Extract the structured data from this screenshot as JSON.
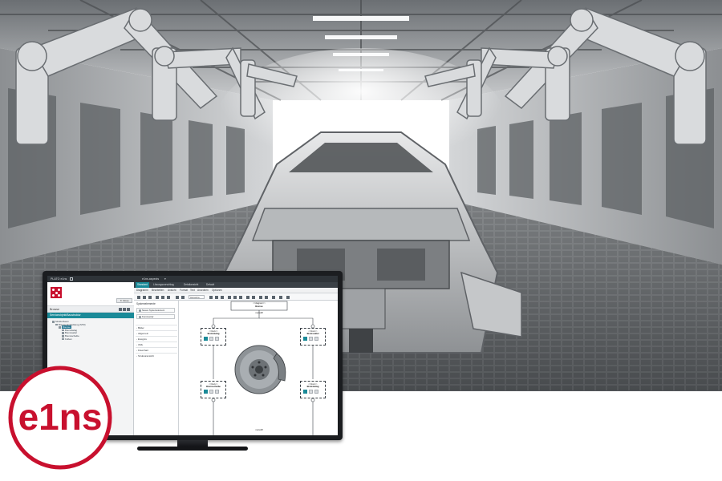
{
  "app": {
    "title": "PLATO e1ns",
    "document_title": "e1ns.aspects",
    "document_caret": "▾"
  },
  "left_panel": {
    "close_label": "✕ Close",
    "panel_title": "Browse",
    "section_label": "Serviceobjekt/Baustruktur",
    "tree": [
      {
        "label": "Strukturbaum",
        "indent": 1,
        "selected": false
      },
      {
        "label": "Bremse Entwicklung (STR)",
        "indent": 2,
        "selected": false
      },
      {
        "label": "Bremse",
        "indent": 3,
        "selected": true
      },
      {
        "label": "Bremsbelag",
        "indent": 4,
        "selected": false
      },
      {
        "label": "Bremssattel",
        "indent": 4,
        "selected": false
      },
      {
        "label": "Bremsscheibe",
        "indent": 4,
        "selected": false
      },
      {
        "label": "Kolben",
        "indent": 4,
        "selected": false
      }
    ]
  },
  "tabs": [
    "Standard",
    "Lösungsvorschlag",
    "Detailansicht",
    "Default"
  ],
  "menu": [
    "Diagramm",
    "Bearbeiten",
    "Ansicht",
    "Format",
    "Text",
    "Anordnen",
    "Optionen"
  ],
  "toolbar": {
    "font_value": "Helvetica"
  },
  "palette": {
    "header": "Systemelemente",
    "buttons": [
      "Neues Systemelement",
      "Kommentar"
    ],
    "categories": [
      "Bilder",
      "Allgemein",
      "Ereignis",
      "UML",
      "Flowchart",
      "Strukturansicht"
    ]
  },
  "diagram": {
    "root_stereotype": "<<diagram>>",
    "root_name": "Bremse",
    "port_top": "menu28",
    "port_bottom": "menu28",
    "blocks": [
      {
        "stereotype": "<<block>>",
        "name": "Bremsbelag"
      },
      {
        "stereotype": "<<block>>",
        "name": "Bremssattel"
      },
      {
        "stereotype": "<<block>>",
        "name": "Bremsscheibe"
      },
      {
        "stereotype": "<<block>>",
        "name": "Bremsbelag"
      }
    ]
  },
  "logo": {
    "text": "e1ns"
  },
  "colors": {
    "brand_red": "#c8102e",
    "accent_teal": "#1a8a98",
    "bezel": "#1b1d20"
  }
}
